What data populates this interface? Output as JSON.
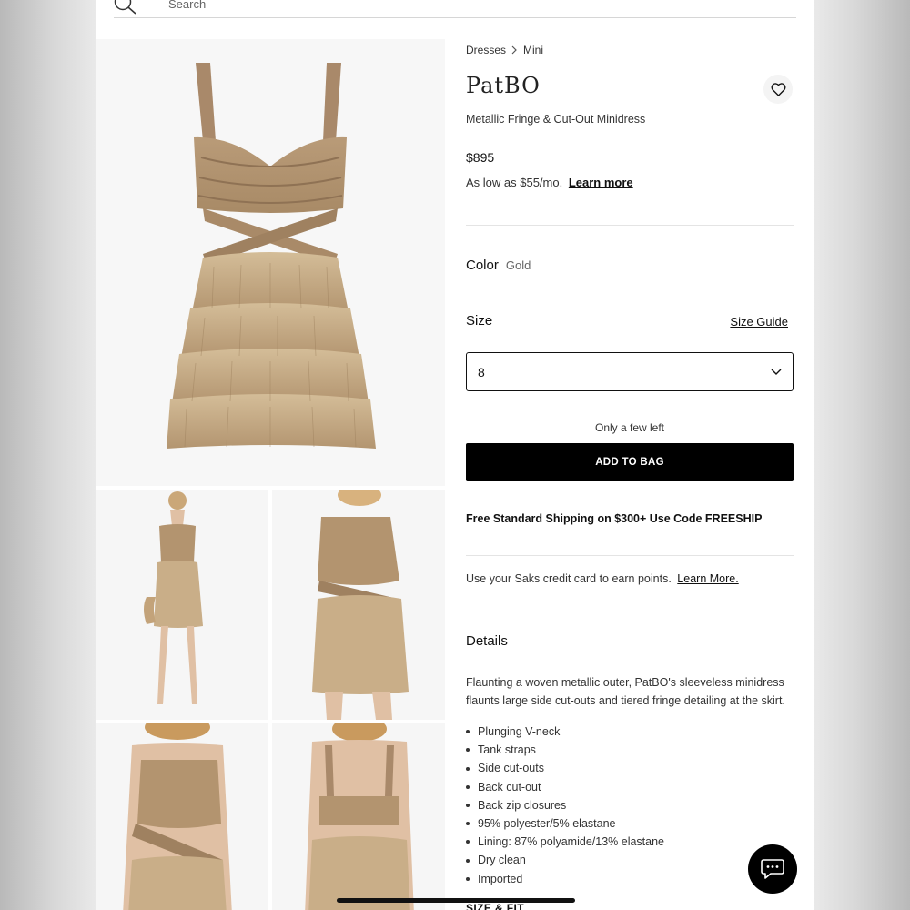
{
  "search": {
    "placeholder": "Search",
    "icon": "search-icon"
  },
  "breadcrumb": {
    "items": [
      "Dresses",
      "Mini"
    ],
    "separator_icon": "chevron-right-icon"
  },
  "product": {
    "brand": "PatBO",
    "name": "Metallic Fringe & Cut-Out Minidress",
    "price": "$895",
    "installment_text": "As low as $55/mo.",
    "installment_link": "Learn more",
    "favorite_icon": "heart-icon"
  },
  "color": {
    "label": "Color",
    "value": "Gold"
  },
  "size": {
    "label": "Size",
    "guide_link": "Size Guide",
    "selected": "8",
    "dropdown_icon": "chevron-down-icon"
  },
  "stock_message": "Only a few left",
  "add_to_bag_label": "ADD TO BAG",
  "shipping_promo": "Free Standard Shipping on $300+ Use Code FREESHIP",
  "credit": {
    "text": "Use your Saks credit card to earn points.",
    "link": "Learn More."
  },
  "details": {
    "heading": "Details",
    "description": "Flaunting a woven metallic outer, PatBO's sleeveless minidress flaunts large side cut-outs and tiered fringe detailing at the skirt.",
    "bullets": [
      "Plunging V-neck",
      "Tank straps",
      "Side cut-outs",
      "Back cut-out",
      "Back zip closures",
      "95% polyester/5% elastane",
      "Lining: 87% polyamide/13% elastane",
      "Dry clean",
      "Imported"
    ]
  },
  "size_fit_heading": "SIZE & FIT",
  "chat_icon": "chat-icon",
  "colors": {
    "button": "#000000",
    "dress_gold": "#c2a57c",
    "background": "#ffffff"
  }
}
